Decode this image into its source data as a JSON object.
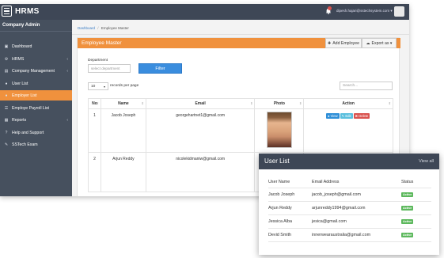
{
  "app": {
    "brand": "HRMS",
    "user_email": "dipesh.hajari@sstechsystem.com ▾"
  },
  "sidebar": {
    "company": "Company Admin",
    "items": [
      {
        "label": "Dashboard",
        "icon": "dashboard-icon",
        "chevron": ""
      },
      {
        "label": "HRMS",
        "icon": "gear-icon",
        "chevron": "‹"
      },
      {
        "label": "Company Management",
        "icon": "building-icon",
        "chevron": "‹"
      },
      {
        "label": "User List",
        "icon": "user-icon",
        "chevron": ""
      },
      {
        "label": "Employer List",
        "icon": "users-icon",
        "chevron": ""
      },
      {
        "label": "Employe Payroll List",
        "icon": "list-icon",
        "chevron": ""
      },
      {
        "label": "Reports",
        "icon": "report-icon",
        "chevron": "‹"
      },
      {
        "label": "Help and Support",
        "icon": "help-icon",
        "chevron": ""
      },
      {
        "label": "SSTech Exam",
        "icon": "exam-icon",
        "chevron": ""
      }
    ],
    "active_index": 4
  },
  "breadcrumb": {
    "home": "Dashboard",
    "separator": "/",
    "current": "Employee Master"
  },
  "panel": {
    "title": "Employee Master",
    "add_button": "Add Employee",
    "export_button": "Export as ▾",
    "department_label": "Department",
    "department_placeholder": "select department",
    "filter_button": "Filter",
    "rows_value": "10",
    "rows_label": "records per page",
    "search_placeholder": "Search..."
  },
  "employee_table": {
    "headers": [
      "No",
      "Name",
      "Email",
      "Photo",
      "Action"
    ],
    "rows": [
      {
        "no": "1",
        "name": "Jacob Joseph",
        "email": "georgehartnet1@gmail.com",
        "has_photo": true
      },
      {
        "no": "2",
        "name": "Arjun Reddy",
        "email": "nicolekidmaniw@gmail.com",
        "has_photo": false
      }
    ],
    "actions": {
      "view": "View",
      "edit": "Edit",
      "delete": "Delete"
    }
  },
  "user_list": {
    "title": "User List",
    "view_all": "View all",
    "headers": [
      "User Name",
      "Email Address",
      "Status"
    ],
    "rows": [
      {
        "name": "Jacob Joseph",
        "email": "jacob_joseph@gmail.com",
        "status": "Active"
      },
      {
        "name": "Arjun Reddy",
        "email": "arjunreddy1994@gmail.com",
        "status": "Active"
      },
      {
        "name": "Jessica Alba",
        "email": "jesica@gmail.com",
        "status": "Active"
      },
      {
        "name": "Devid Smith",
        "email": "innerwearaustralia@gmail.com",
        "status": "Active"
      }
    ]
  },
  "colors": {
    "topbar": "#3e4756",
    "sidebar": "#46505e",
    "accent": "#f0913d",
    "primary": "#3a8dde",
    "success": "#5cb85c",
    "view": "#2f8fd8",
    "edit": "#5bc0de",
    "delete": "#d9534f"
  }
}
